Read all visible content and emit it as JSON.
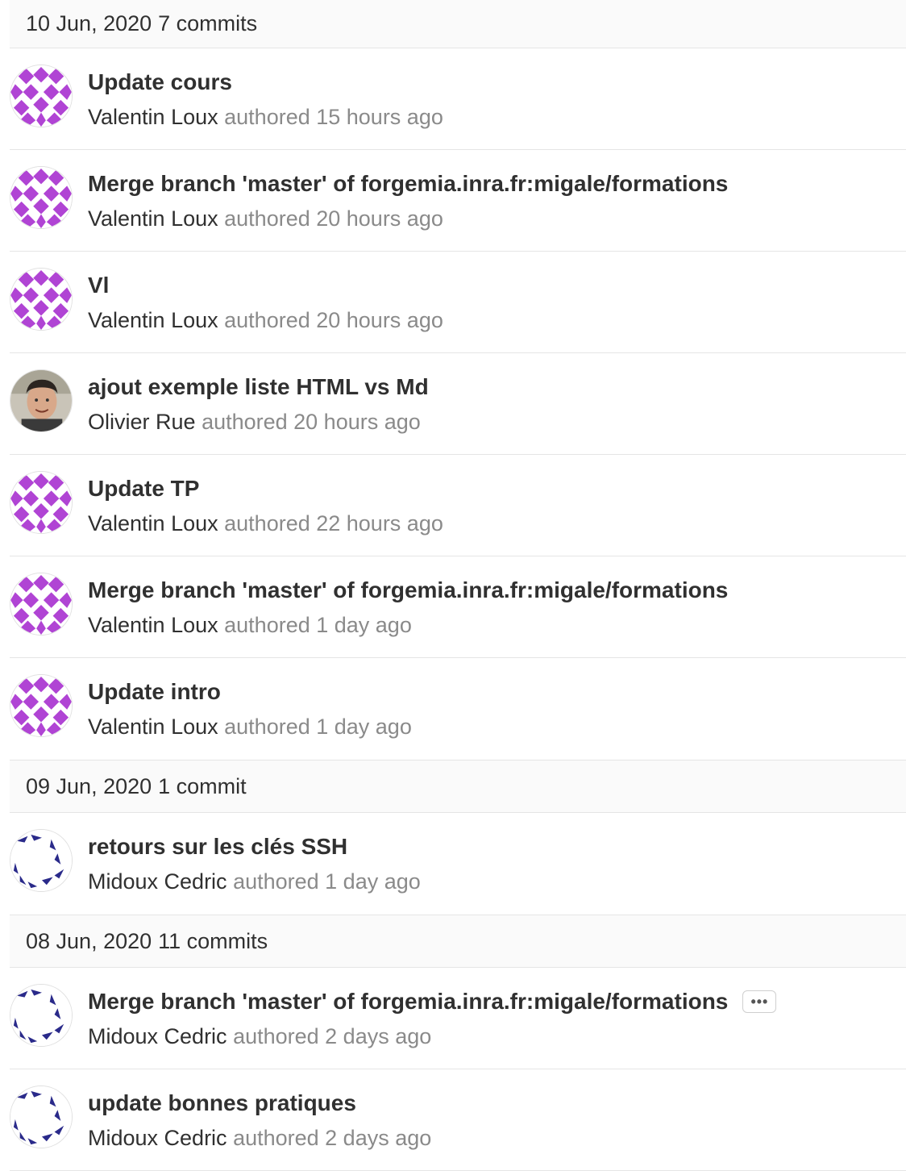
{
  "groups": [
    {
      "date": "10 Jun, 2020",
      "count": "7 commits",
      "commits": [
        {
          "title": "Update cours",
          "author": "Valentin Loux",
          "time": "authored 15 hours ago",
          "avatar": "identicon-purple"
        },
        {
          "title": "Merge branch 'master' of forgemia.inra.fr:migale/formations",
          "author": "Valentin Loux",
          "time": "authored 20 hours ago",
          "avatar": "identicon-purple"
        },
        {
          "title": "Vl",
          "author": "Valentin Loux",
          "time": "authored 20 hours ago",
          "avatar": "identicon-purple"
        },
        {
          "title": "ajout exemple liste HTML vs Md",
          "author": "Olivier Rue",
          "time": "authored 20 hours ago",
          "avatar": "photo"
        },
        {
          "title": "Update TP",
          "author": "Valentin Loux",
          "time": "authored 22 hours ago",
          "avatar": "identicon-purple"
        },
        {
          "title": "Merge branch 'master' of forgemia.inra.fr:migale/formations",
          "author": "Valentin Loux",
          "time": "authored 1 day ago",
          "avatar": "identicon-purple"
        },
        {
          "title": "Update intro",
          "author": "Valentin Loux",
          "time": "authored 1 day ago",
          "avatar": "identicon-purple"
        }
      ]
    },
    {
      "date": "09 Jun, 2020",
      "count": "1 commit",
      "commits": [
        {
          "title": "retours sur les clés SSH",
          "author": "Midoux Cedric",
          "time": "authored 1 day ago",
          "avatar": "identicon-blue"
        }
      ]
    },
    {
      "date": "08 Jun, 2020",
      "count": "11 commits",
      "commits": [
        {
          "title": "Merge branch 'master' of forgemia.inra.fr:migale/formations",
          "author": "Midoux Cedric",
          "time": "authored 2 days ago",
          "avatar": "identicon-blue",
          "ellipsis": "•••"
        },
        {
          "title": "update bonnes pratiques",
          "author": "Midoux Cedric",
          "time": "authored 2 days ago",
          "avatar": "identicon-blue"
        }
      ]
    }
  ],
  "colors": {
    "identicon_purple": "#b044d4",
    "identicon_blue": "#2a2a8a"
  }
}
